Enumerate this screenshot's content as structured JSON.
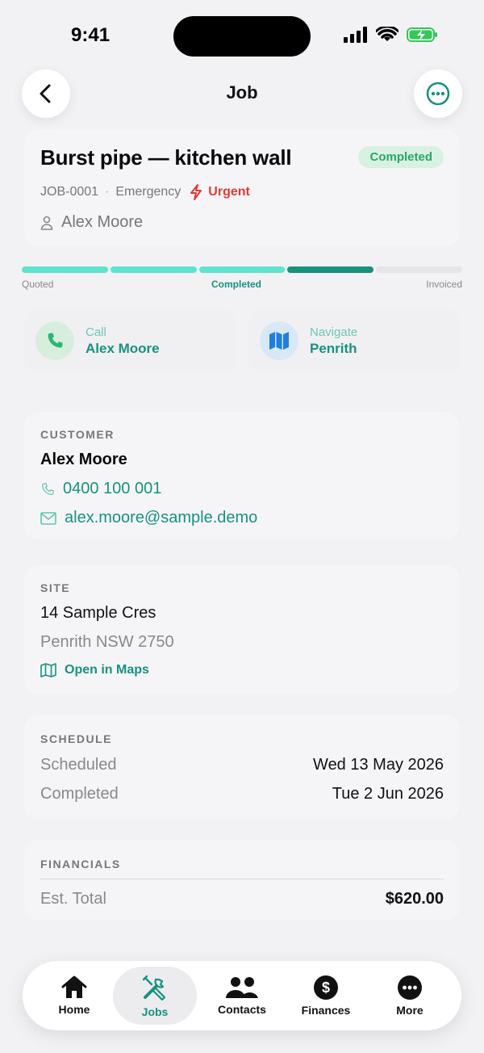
{
  "status": {
    "time": "9:41"
  },
  "nav": {
    "title": "Job",
    "back_icon": "chevron-left-icon",
    "more_icon": "ellipsis-circle-icon"
  },
  "job": {
    "title": "Burst pipe — kitchen wall",
    "status": "Completed",
    "id": "JOB-0001",
    "type": "Emergency",
    "priority": "Urgent",
    "assignee": "Alex Moore"
  },
  "progress": {
    "segments_total": 5,
    "segments_done": 3,
    "current_index": 3,
    "label_start": "Quoted",
    "label_current": "Completed",
    "label_end": "Invoiced"
  },
  "actions": {
    "call": {
      "label": "Call",
      "value": "Alex Moore"
    },
    "navigate": {
      "label": "Navigate",
      "value": "Penrith"
    }
  },
  "customer": {
    "section": "CUSTOMER",
    "name": "Alex Moore",
    "phone": "0400 100 001",
    "email": "alex.moore@sample.demo"
  },
  "site": {
    "section": "SITE",
    "street": "14 Sample Cres",
    "suburb": "Penrith NSW 2750",
    "maps_link": "Open in Maps"
  },
  "schedule": {
    "section": "SCHEDULE",
    "scheduled_label": "Scheduled",
    "scheduled_value": "Wed 13 May 2026",
    "completed_label": "Completed",
    "completed_value": "Tue 2 Jun 2026"
  },
  "financials": {
    "section": "FINANCIALS",
    "est_total_label": "Est. Total",
    "est_total_value": "$620.00"
  },
  "tabbar": {
    "items": [
      {
        "label": "Home",
        "icon": "house-icon"
      },
      {
        "label": "Jobs",
        "icon": "tools-icon"
      },
      {
        "label": "Contacts",
        "icon": "people-icon"
      },
      {
        "label": "Finances",
        "icon": "dollar-circle-icon"
      },
      {
        "label": "More",
        "icon": "ellipsis-circle-icon"
      }
    ],
    "active": "Jobs"
  },
  "colors": {
    "accent": "#16927e",
    "accent_light": "#5ee3cf",
    "urgent": "#e53935",
    "badge_green": "#26a86a"
  }
}
